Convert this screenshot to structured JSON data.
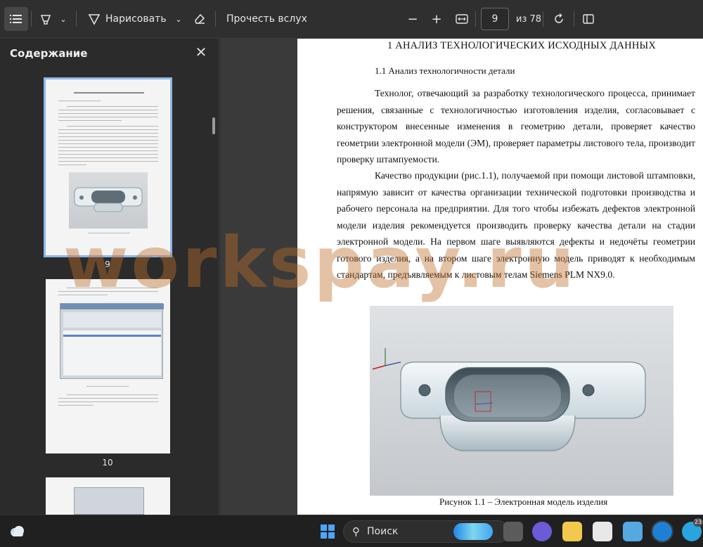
{
  "toolbar": {
    "draw_label": "Нарисовать",
    "read_aloud_label": "Прочесть вслух",
    "page_current": "9",
    "page_total": "из 78"
  },
  "sidebar": {
    "title": "Содержание",
    "thumbnails": [
      {
        "page": "9"
      },
      {
        "page": "10"
      }
    ]
  },
  "document": {
    "heading": "1 АНАЛИЗ ТЕХНОЛОГИЧЕСКИХ ИСХОДНЫХ ДАННЫХ",
    "subheading": "1.1 Анализ технологичности детали",
    "paragraph1": "Технолог, отвечающий за разработку технологического процесса, принимает решения, связанные с технологичностью изготовления изделия, согласовывает с конструктором внесенные изменения в геометрию детали, проверяет качество геометрии электронной модели (ЭМ), проверяет параметры листового тела, производит проверку штампуемости.",
    "paragraph2": "Качество продукции (рис.1.1), получаемой при помощи листовой штамповки, напрямую зависит от качества организации технической подготовки производства и рабочего персонала на предприятии. Для того чтобы избежать дефектов электронной модели изделия рекомендуется производить проверку качества детали на стадии электронной модели. На первом шаге выявляются дефекты и недочёты геометрии готового изделия, а на втором шаге электронную модель приводят к необходимым стандартам, предъявляемым к листовым телам Siemens PLM NX9.0.",
    "caption": "Рисунок 1.1 – Электронная модель изделия"
  },
  "watermark": "workspay.ru",
  "taskbar": {
    "search_placeholder": "Поиск",
    "notification_count": "23"
  },
  "colors": {
    "toolbar_bg": "#2f2f2f",
    "sidebar_bg": "#2b2b2b",
    "thumb_selected": "#8fb7e6",
    "watermark": "#be6e28"
  }
}
